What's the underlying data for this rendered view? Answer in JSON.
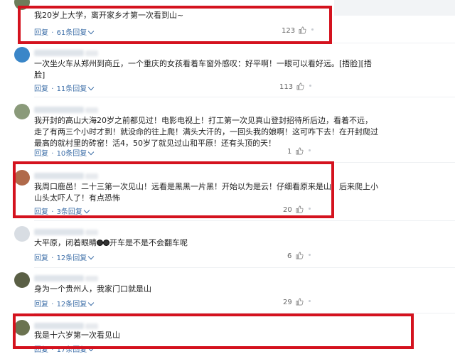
{
  "comments": [
    {
      "text_lines": [
        "我20岁上大学，离开家乡才第一次看到山~"
      ],
      "reply_label": "回复",
      "sep": "·",
      "replies_label": "61条回复",
      "likes": "123"
    },
    {
      "text_lines": [
        "一次坐火车从郑州到商丘，一个重庆的女孩看着车窗外感叹：好平啊！一眼可以看好远。[捂脸][捂",
        "脸]"
      ],
      "reply_label": "回复",
      "sep": "·",
      "replies_label": "11条回复",
      "likes": "113"
    },
    {
      "text_lines": [
        "我开封的高山大海20岁之前都见过！电影电视上！打工第一次见真山登封招待所后边，看着不远，",
        "走了有两三个小时才到！就没命的往上爬！满头大汗的，一回头我的娘啊！这可咋下去！在开封爬过",
        "最高的就村里的砖窑！活4，50岁了就见过山和平原！还有头顶的天！"
      ],
      "reply_label": "回复",
      "sep": "·",
      "replies_label": "10条回复",
      "likes": "1"
    },
    {
      "text_lines": [
        "我周口鹿邑！二十三第一次见山！远看是黑黑一片黑！开始以为是云！仔细看原来是山！后来爬上小",
        "山头太吓人了！有点恐怖"
      ],
      "reply_label": "回复",
      "sep": "·",
      "replies_label": "3条回复",
      "likes": "20"
    },
    {
      "text_lines": [
        "大平原，闭着眼睛",
        "开车是不是不会翻车呢"
      ],
      "reply_label": "回复",
      "sep": "·",
      "replies_label": "12条回复",
      "likes": "6"
    },
    {
      "text_lines": [
        "身为一个贵州人，我家门口就是山"
      ],
      "reply_label": "回复",
      "sep": "·",
      "replies_label": "12条回复",
      "likes": "29"
    },
    {
      "text_lines": [
        "我是十六岁第一次看见山"
      ],
      "reply_label": "回复",
      "sep": "·",
      "replies_label": "17条回复",
      "likes": ""
    }
  ],
  "colors": {
    "highlight": "#d4121e",
    "link": "#3e6fa8"
  },
  "icons": {
    "like": "thumbs-up-icon",
    "expand": "chevron-down-icon",
    "emoji": "eyes-emoji-icon"
  }
}
